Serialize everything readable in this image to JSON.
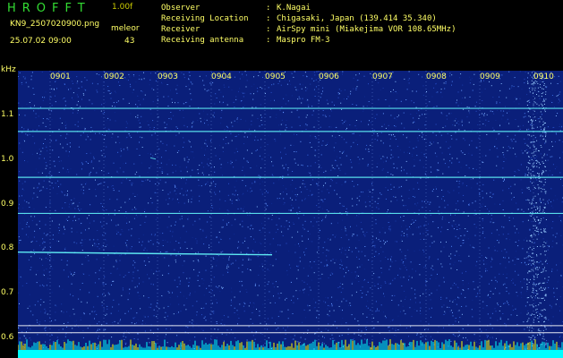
{
  "header": {
    "app_title": "HROFFT",
    "version": "1.00f",
    "filename": "KN9_2507020900.png",
    "mode": "meleor",
    "datetime": "25.07.02 09:00",
    "count": "43"
  },
  "info": [
    {
      "label": "Observer",
      "value": "K.Nagai"
    },
    {
      "label": "Receiving Location",
      "value": "Chigasaki, Japan (139.414 35.340)"
    },
    {
      "label": "Receiver",
      "value": "AirSpy mini (Miakejima VOR 108.65MHz)"
    },
    {
      "label": "Receiving antenna",
      "value": "Maspro FM-3"
    }
  ],
  "y_axis": {
    "unit": "kHz",
    "labels": [
      "1.1",
      "1.0",
      "0.9",
      "0.8",
      "0.7",
      "0.6"
    ]
  },
  "time_axis": {
    "labels": [
      "0901",
      "0902",
      "0903",
      "0904",
      "0905",
      "0906",
      "0907",
      "0908",
      "0909",
      "0910"
    ]
  },
  "signals": [
    {
      "freq_khz": 1.116,
      "kind": "carrier"
    },
    {
      "freq_khz": 1.064,
      "kind": "carrier"
    },
    {
      "freq_khz": 0.961,
      "kind": "carrier"
    },
    {
      "freq_khz": 0.88,
      "kind": "carrier"
    },
    {
      "freq_khz": 0.793,
      "kind": "meteor-trail",
      "start_time": "0901",
      "end_time": "0905"
    },
    {
      "freq_khz": 0.628,
      "kind": "reference"
    },
    {
      "freq_khz": 0.612,
      "kind": "reference"
    }
  ],
  "colors": {
    "background": "#000000",
    "plot_bg": "#0a1f7a",
    "text_yellow": "#ffff66",
    "title_green": "#33dd33",
    "trace": "#66ffff",
    "noise_floor": "#00ffff",
    "spike": "#ffff00"
  }
}
